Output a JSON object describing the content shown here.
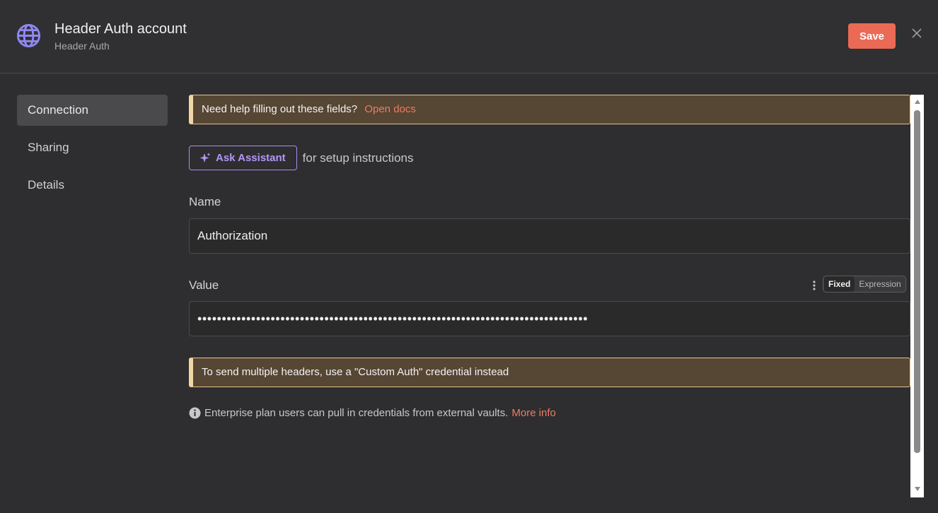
{
  "header": {
    "title": "Header Auth account",
    "subtitle": "Header Auth",
    "save_label": "Save",
    "icon": "globe-icon"
  },
  "sidebar": {
    "items": [
      {
        "label": "Connection",
        "active": true
      },
      {
        "label": "Sharing",
        "active": false
      },
      {
        "label": "Details",
        "active": false
      }
    ]
  },
  "main": {
    "help_notice": {
      "text": "Need help filling out these fields?",
      "link": "Open docs"
    },
    "assistant": {
      "button_label": "Ask Assistant",
      "suffix": "for setup instructions"
    },
    "name_field": {
      "label": "Name",
      "value": "Authorization"
    },
    "value_field": {
      "label": "Value",
      "value": "••••••••••••••••••••••••••••••••••••••••••••••••••••••••••••••••••••••••••••••••",
      "mode_options": [
        "Fixed",
        "Expression"
      ],
      "selected_mode": "Fixed"
    },
    "headers_notice": {
      "text": "To send multiple headers, use a \"Custom Auth\" credential instead"
    },
    "vault_info": {
      "text": "Enterprise plan users can pull in credentials from external vaults.",
      "link": "More info"
    }
  },
  "colors": {
    "accent": "#ea6a55",
    "link": "#ef7a63",
    "assistant": "#b496f7",
    "notice_bg": "#564634",
    "notice_border": "#f2d6a6"
  }
}
